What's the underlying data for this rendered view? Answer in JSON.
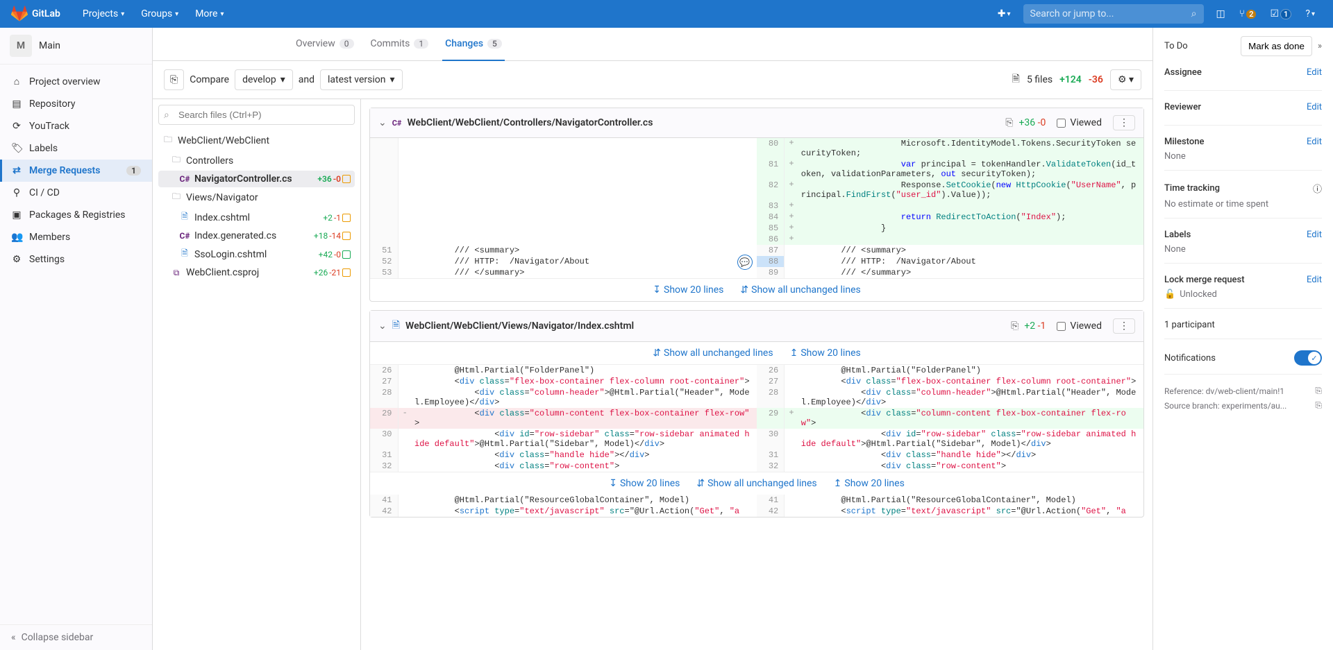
{
  "topbar": {
    "brand": "GitLab",
    "nav": [
      "Projects",
      "Groups",
      "More"
    ],
    "search_placeholder": "Search or jump to...",
    "merge_badge": "2",
    "todo_badge": "1"
  },
  "sidebar": {
    "project_initial": "M",
    "project_name": "Main",
    "items": [
      {
        "icon": "⌂",
        "label": "Project overview"
      },
      {
        "icon": "▤",
        "label": "Repository"
      },
      {
        "icon": "⟳",
        "label": "YouTrack"
      },
      {
        "icon": "🏷",
        "label": "Labels"
      },
      {
        "icon": "⇄",
        "label": "Merge Requests",
        "badge": "1",
        "active": true
      },
      {
        "icon": "⚲",
        "label": "CI / CD"
      },
      {
        "icon": "▣",
        "label": "Packages & Registries"
      },
      {
        "icon": "👥",
        "label": "Members"
      },
      {
        "icon": "⚙",
        "label": "Settings"
      }
    ],
    "collapse": "Collapse sidebar"
  },
  "tabs": {
    "overview": {
      "label": "Overview",
      "count": "0"
    },
    "commits": {
      "label": "Commits",
      "count": "1"
    },
    "changes": {
      "label": "Changes",
      "count": "5"
    }
  },
  "compare": {
    "label": "Compare",
    "source": "develop",
    "and": "and",
    "target": "latest version",
    "files_count": "5 files",
    "additions": "+124",
    "deletions": "-36"
  },
  "file_tree": {
    "search_placeholder": "Search files (Ctrl+P)",
    "root": "WebClient/WebClient",
    "controllers_folder": "Controllers",
    "views_folder": "Views/Navigator",
    "files": {
      "nav_controller": {
        "name": "NavigatorController.cs",
        "a": "+36",
        "d": "-0"
      },
      "index_cshtml": {
        "name": "Index.cshtml",
        "a": "+2",
        "d": "-1"
      },
      "index_gen": {
        "name": "Index.generated.cs",
        "a": "+18",
        "d": "-14"
      },
      "sso_login": {
        "name": "SsoLogin.cshtml",
        "a": "+42",
        "d": "-0"
      },
      "csproj": {
        "name": "WebClient.csproj",
        "a": "+26",
        "d": "-21"
      }
    }
  },
  "file1": {
    "path": "WebClient/WebClient/Controllers/NavigatorController.cs",
    "additions": "+36",
    "deletions": "-0",
    "viewed": "Viewed",
    "show20": "Show 20 lines",
    "showall": "Show all unchanged lines"
  },
  "file2": {
    "path": "WebClient/WebClient/Views/Navigator/Index.cshtml",
    "additions": "+2",
    "deletions": "-1",
    "viewed": "Viewed",
    "showall": "Show all unchanged lines",
    "show20": "Show 20 lines"
  },
  "right": {
    "todo": "To Do",
    "done": "Mark as done",
    "assignee": "Assignee",
    "reviewer": "Reviewer",
    "milestone": "Milestone",
    "none": "None",
    "time_tracking": "Time tracking",
    "time_val": "No estimate or time spent",
    "labels": "Labels",
    "lock": "Lock merge request",
    "unlocked": "Unlocked",
    "participant": "1 participant",
    "notifications": "Notifications",
    "reference_label": "Reference:",
    "reference_val": "dv/web-client/main!1",
    "source_label": "Source branch:",
    "source_val": "experiments/au...",
    "edit": "Edit"
  },
  "code1": {
    "l80": "                    Microsoft.IdentityModel.Tokens.SecurityToken securityToken;",
    "l81a": "                    ",
    "l81b": " principal = tokenHandler.",
    "l81c": "(id_token, validationParameters, ",
    "l81d": " securityToken);",
    "l82a": "                    Response.",
    "l82b": "(",
    "l82c": " ",
    "l82d": "(",
    "l82e": ", principal.",
    "l82f": "(",
    "l82g": ").Value));",
    "l83": "",
    "l84a": "                    ",
    "l84b": " ",
    "l84c": "(",
    "l84d": ");",
    "l85": "                }",
    "l86": "",
    "l51": "        /// <summary>",
    "l52": "        /// HTTP:  /Navigator/About",
    "l53": "        /// </summary>",
    "var": "var",
    "out": "out",
    "new": "new",
    "return": "return",
    "ValidateToken": "ValidateToken",
    "SetCookie": "SetCookie",
    "HttpCookie": "HttpCookie",
    "UserName": "\"UserName\"",
    "FindFirst": "FindFirst",
    "user_id": "\"user_id\"",
    "RedirectToAction": "RedirectToAction",
    "Index": "\"Index\""
  },
  "code2": {
    "l26": "        @Html.Partial(\"FolderPanel\")",
    "l27a": "        <",
    "l27b": " ",
    "l27c": "=",
    "l27d": ">",
    "l28a": "            <",
    "l28b": " ",
    "l28c": "=",
    "l28d": ">@Html.Partial(\"Header\", Model.Employee)</",
    "l28e": ">",
    "l29a": "            <",
    "l29b": " ",
    "l29c": "=",
    "l29dL": " >",
    "l29dR": ">",
    "l30a": "                <",
    "l30b": " ",
    "l30c": "=",
    "l30d": " ",
    "l30e": "=",
    "l30f": ">@Html.Partial(\"Sidebar\", Model)</",
    "l30g": ">",
    "l31a": "                <",
    "l31b": " ",
    "l31c": "=",
    "l31d": "></",
    "l31e": ">",
    "l32a": "                <",
    "l32b": " ",
    "l32c": "=",
    "l32d": ">",
    "l41": "        @Html.Partial(\"ResourceGlobalContainer\", Model)",
    "l42a": "        <",
    "l42b": " ",
    "l42c": "=",
    "l42d": " ",
    "l42e": "=",
    "l42f": "@Url.Action(",
    "div": "div",
    "script": "script",
    "class": "class",
    "id": "id",
    "type": "type",
    "src": "src",
    "flexbox": "\"flex-box-container flex-column root-container\"",
    "colheader": "\"column-header\"",
    "colcontent": "\"column-content flex-box-container flex-row\"",
    "rowsidebar_id": "\"row-sidebar\"",
    "rowsidebar_cls": "\"row-sidebar animated hide default\"",
    "handlehide": "\"handle hide\"",
    "rowcontent": "\"row-content\"",
    "textjs": "\"text/javascript\"",
    "get": "\"Get\"",
    "a": "\"a"
  }
}
